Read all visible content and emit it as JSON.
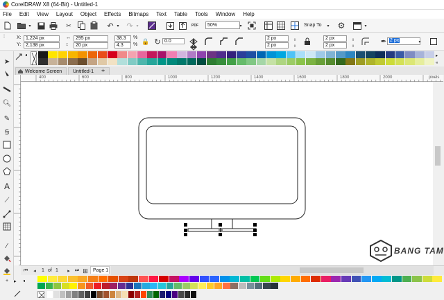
{
  "app": {
    "title": "CorelDRAW X8 (64-Bit) - Untitled-1"
  },
  "menu": [
    "File",
    "Edit",
    "View",
    "Layout",
    "Object",
    "Effects",
    "Bitmaps",
    "Text",
    "Table",
    "Tools",
    "Window",
    "Help"
  ],
  "toolbar": {
    "zoom": "50%",
    "snap_label": "Snap To"
  },
  "props": {
    "x": "1,224 px",
    "y": "2,138 px",
    "w": "295 px",
    "h": "20 px",
    "sx": "38.3",
    "sy": "4.3",
    "pct": "%",
    "rotation": "0.0",
    "corner_tl": "2 px",
    "corner_bl": "2 px",
    "corner_tr": "2 px",
    "corner_br": "2 px",
    "outline": "2 px"
  },
  "tabs": {
    "welcome": "Welcome Screen",
    "doc": "Untitled-1"
  },
  "ruler": {
    "ticks": [
      "400",
      "600",
      "800",
      "1000",
      "1200",
      "1400",
      "1600",
      "1800",
      "2000"
    ],
    "unit": "pixels"
  },
  "pages": {
    "current": "1",
    "of_label": "of",
    "total": "1",
    "page_tab": "Page 1"
  },
  "watermark": "BANG TAM",
  "colors": {
    "accent": "#1e6fd9",
    "palette_top_row1": [
      "#1a1a1a",
      "#ffe500",
      "#ffd200",
      "#f7b500",
      "#f39200",
      "#ec6608",
      "#e94e1b",
      "#d6001c",
      "#f08a8a",
      "#f4a3b0",
      "#e6679c",
      "#c2185b",
      "#a8126a",
      "#ef7fb2",
      "#d2b4de",
      "#b07cc6",
      "#8e44ad",
      "#6c3483",
      "#512e8c",
      "#34227c",
      "#2c3e9a",
      "#1e4fa3",
      "#0066b3",
      "#0093d7",
      "#00a7e1",
      "#4fc3f7",
      "#a9def9",
      "#cde7f5",
      "#9ec9e8",
      "#7fb3d5",
      "#5499c7",
      "#2e86c1",
      "#1b4f72",
      "#154360",
      "#0e2e59",
      "#253b80",
      "#3b5ba5",
      "#7f8cc2",
      "#a7b3d9",
      "#c7cee8"
    ],
    "palette_top_row2": [
      "#2f2f2f",
      "#c7b299",
      "#a68b6d",
      "#8b6d4e",
      "#6b4e2e",
      "#c4a484",
      "#e0c9a6",
      "#f2e2c4",
      "#b2dfdb",
      "#80cbc4",
      "#4db6ac",
      "#26a69a",
      "#009688",
      "#00897b",
      "#00796b",
      "#00695c",
      "#004d40",
      "#2e7d32",
      "#388e3c",
      "#43a047",
      "#66bb6a",
      "#81c784",
      "#a5d6a7",
      "#c5e1a5",
      "#aed581",
      "#9ccc65",
      "#8bc34a",
      "#7cb342",
      "#689f38",
      "#558b2f",
      "#33691e",
      "#827717",
      "#9e9d24",
      "#afb42b",
      "#c0ca33",
      "#cddc39",
      "#d4e157",
      "#dce775",
      "#e6ee9c",
      "#f0f4c3"
    ],
    "palette_bottom_row1": [
      "#ffff00",
      "#ffeb3b",
      "#fdd835",
      "#fbc02d",
      "#f9a825",
      "#f57f17",
      "#ff6f00",
      "#e65100",
      "#d84315",
      "#bf360c",
      "#ff5252",
      "#ff1744",
      "#d50000",
      "#c51162",
      "#aa00ff",
      "#6200ea",
      "#304ffe",
      "#2962ff",
      "#0091ea",
      "#00b8d4",
      "#00bfa5",
      "#00c853",
      "#64dd17",
      "#aeea00",
      "#ffd600",
      "#ffab00",
      "#ff6d00",
      "#dd2c00",
      "#e91e63",
      "#9c27b0",
      "#673ab7",
      "#3f51b5",
      "#2196f3",
      "#03a9f4",
      "#00bcd4",
      "#009688",
      "#4caf50",
      "#8bc34a",
      "#cddc39",
      "#ffeb3b"
    ],
    "palette_bottom_row2": [
      "#00a651",
      "#39b54a",
      "#8dc63f",
      "#d7df23",
      "#fff200",
      "#f7941d",
      "#f15a29",
      "#ed1c24",
      "#be1e2d",
      "#9e1f63",
      "#662d91",
      "#2e3192",
      "#1b75bc",
      "#27aae1",
      "#29b6f6",
      "#26c6da",
      "#26a69a",
      "#66bb6a",
      "#9ccc65",
      "#d4e157",
      "#ffee58",
      "#ffca28",
      "#ffa726",
      "#ff7043",
      "#8d6e63",
      "#bdbdbd",
      "#78909c",
      "#546e7a",
      "#37474f",
      "#263238"
    ],
    "palette_bottom_row3": [
      "#ffffff",
      "#e0e0e0",
      "#c0c0c0",
      "#a0a0a0",
      "#808080",
      "#606060",
      "#404040",
      "#000000",
      "#7b4a2a",
      "#a0522d",
      "#cd853f",
      "#deb887",
      "#f5deb3",
      "#8b0000",
      "#b22222",
      "#ff4500",
      "#2e8b57",
      "#006400",
      "#191970",
      "#000080",
      "#4b0082",
      "#4a4a4a",
      "#2b2b2b",
      "#111111"
    ]
  }
}
